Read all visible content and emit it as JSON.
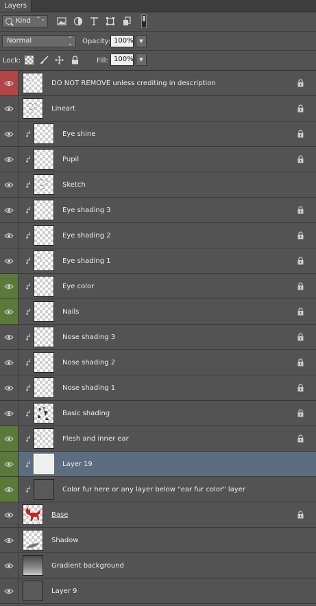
{
  "panel": {
    "tab_title": "Layers"
  },
  "filter": {
    "kind_label": "Kind",
    "kind_arrows": "⌃⌄"
  },
  "blend": {
    "mode": "Normal",
    "opacity_label": "Opacity:",
    "opacity_value": "100%",
    "fill_label": "Fill:",
    "fill_value": "100%"
  },
  "lock": {
    "label": "Lock:"
  },
  "layers": [
    {
      "name": "DO NOT REMOVE unless crediting in description",
      "eye": "red",
      "clipped": false,
      "thumb": "checker-dots",
      "locked": true
    },
    {
      "name": "Lineart",
      "eye": "normal",
      "clipped": false,
      "thumb": "checker-sketch",
      "locked": true
    },
    {
      "name": "Eye shine",
      "eye": "normal",
      "clipped": true,
      "thumb": "checker",
      "locked": true
    },
    {
      "name": "Pupil",
      "eye": "normal",
      "clipped": true,
      "thumb": "checker",
      "locked": true
    },
    {
      "name": "Sketch",
      "eye": "normal",
      "clipped": true,
      "thumb": "checker-sketch",
      "locked": false
    },
    {
      "name": "Eye shading 3",
      "eye": "normal",
      "clipped": true,
      "thumb": "checker",
      "locked": true
    },
    {
      "name": "Eye shading 2",
      "eye": "normal",
      "clipped": true,
      "thumb": "checker",
      "locked": true
    },
    {
      "name": "Eye shading 1",
      "eye": "normal",
      "clipped": true,
      "thumb": "checker-dots",
      "locked": true
    },
    {
      "name": "Eye color",
      "eye": "green",
      "clipped": true,
      "thumb": "checker",
      "locked": true
    },
    {
      "name": "Nails",
      "eye": "green",
      "clipped": true,
      "thumb": "checker",
      "locked": true
    },
    {
      "name": "Nose shading 3",
      "eye": "normal",
      "clipped": true,
      "thumb": "checker",
      "locked": true
    },
    {
      "name": "Nose shading 2",
      "eye": "normal",
      "clipped": true,
      "thumb": "checker",
      "locked": true
    },
    {
      "name": "Nose shading 1",
      "eye": "normal",
      "clipped": true,
      "thumb": "checker",
      "locked": true
    },
    {
      "name": "Basic shading",
      "eye": "normal",
      "clipped": true,
      "thumb": "checker-shading",
      "locked": true
    },
    {
      "name": "Flesh and inner ear",
      "eye": "green",
      "clipped": true,
      "thumb": "checker-dots",
      "locked": true
    },
    {
      "name": "Layer 19",
      "eye": "green",
      "clipped": true,
      "thumb": "white",
      "locked": false,
      "selected": true
    },
    {
      "name": "Color fur here or any layer below \"ear fur color\" layer",
      "eye": "green",
      "clipped": true,
      "thumb": "dark",
      "locked": false
    },
    {
      "name": "Base",
      "eye": "normal",
      "clipped": false,
      "thumb": "red-dog",
      "locked": true,
      "underline": true
    },
    {
      "name": "Shadow",
      "eye": "normal",
      "clipped": false,
      "thumb": "checker-shadow",
      "locked": false
    },
    {
      "name": "Gradient background",
      "eye": "normal",
      "clipped": false,
      "thumb": "gradient",
      "locked": false
    },
    {
      "name": "Layer 9",
      "eye": "normal",
      "clipped": false,
      "thumb": "dark",
      "locked": false
    }
  ],
  "colors": {
    "eye_red": "#b24545",
    "eye_green": "#5a7a3a",
    "selected_row": "#5c6d80",
    "panel_bg": "#535353",
    "base_red": "#cc2222"
  }
}
